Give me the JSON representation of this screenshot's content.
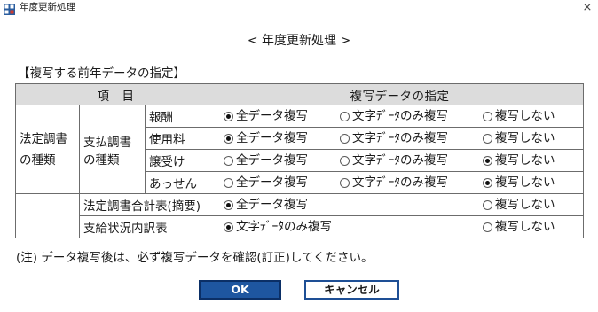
{
  "window": {
    "title": "年度更新処理",
    "close_glyph": "×"
  },
  "heading": "< 年度更新処理 >",
  "section_label": "【複写する前年データの指定】",
  "table": {
    "header_item": "項　目",
    "header_spec": "複写データの指定",
    "group_main": [
      "法定調書",
      "の種類"
    ],
    "group_sub": [
      "支払調書",
      "の種類"
    ],
    "rows": {
      "hoshu": {
        "label": "報酬",
        "opt_all": "全データ複写",
        "opt_text": "文字ﾃﾞｰﾀのみ複写",
        "opt_none": "複写しない",
        "selected": "all"
      },
      "shiyoryo": {
        "label": "使用料",
        "opt_all": "全データ複写",
        "opt_text": "文字ﾃﾞｰﾀのみ複写",
        "opt_none": "複写しない",
        "selected": "all"
      },
      "joju": {
        "label": "譲受け",
        "opt_all": "全データ複写",
        "opt_text": "文字ﾃﾞｰﾀのみ複写",
        "opt_none": "複写しない",
        "selected": "none"
      },
      "assen": {
        "label": "あっせん",
        "opt_all": "全データ複写",
        "opt_text": "文字ﾃﾞｰﾀのみ複写",
        "opt_none": "複写しない",
        "selected": "none"
      },
      "gokei": {
        "label": "法定調書合計表(摘要)",
        "opt_all": "全データ複写",
        "opt_none": "複写しない",
        "selected": "all"
      },
      "shikyu": {
        "label": "支給状況内訳表",
        "opt_text": "文字ﾃﾞｰﾀのみ複写",
        "opt_none": "複写しない",
        "selected": "text"
      }
    }
  },
  "note": "(注) データ複写後は、必ず複写データを確認(訂正)してください。",
  "buttons": {
    "ok": "OK",
    "cancel": "キャンセル"
  },
  "colors": {
    "ok_bg": "#1e56a0",
    "header_bg": "#dcdcdc",
    "grid_line": "#6c6c6c"
  }
}
